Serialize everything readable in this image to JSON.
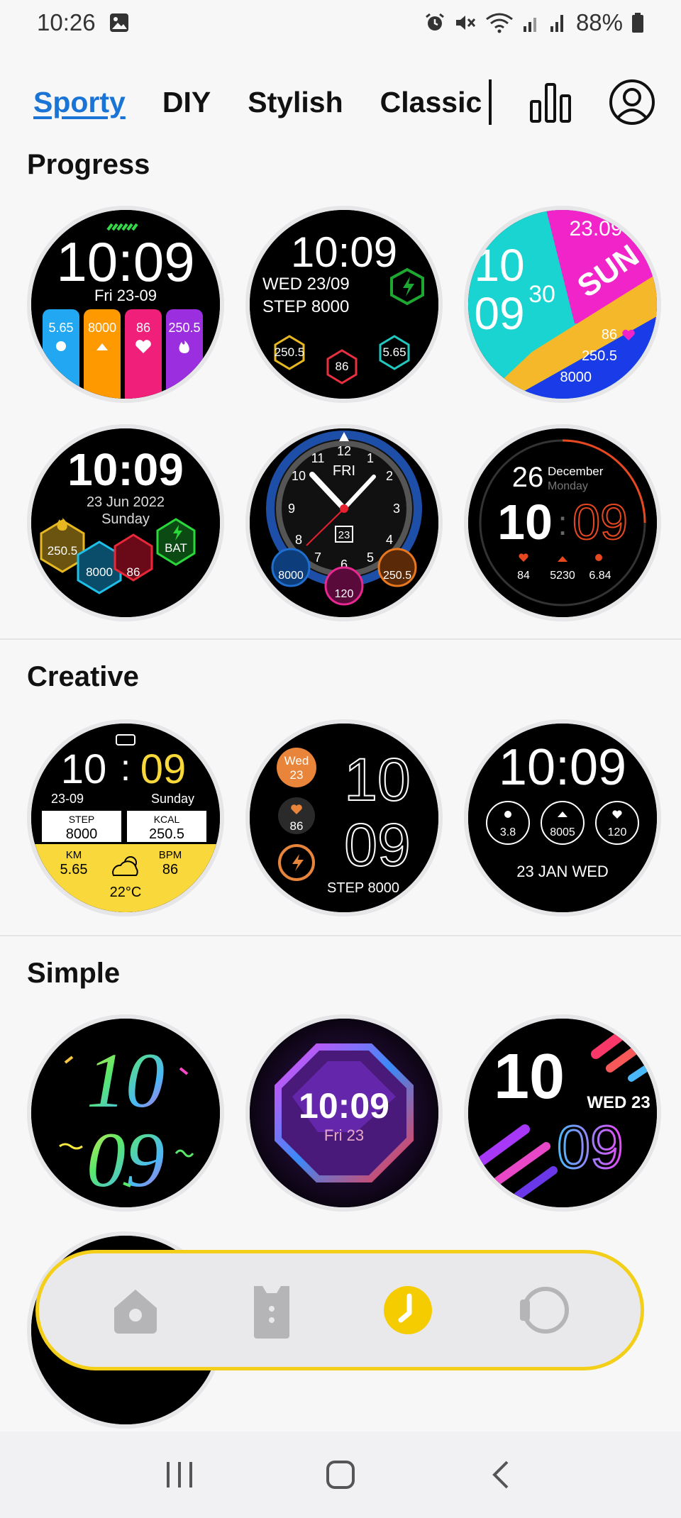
{
  "status_bar": {
    "time": "10:26",
    "battery": "88%",
    "icons": [
      "image-icon",
      "alarm-icon",
      "mute-icon",
      "wifi-icon",
      "signal-icon",
      "signal-2-icon",
      "battery-icon"
    ]
  },
  "tabs": [
    {
      "label": "Sporty",
      "active": true
    },
    {
      "label": "DIY",
      "active": false
    },
    {
      "label": "Stylish",
      "active": false
    },
    {
      "label": "Classic",
      "active": false
    }
  ],
  "header_icons": [
    "stats-icon",
    "profile-icon"
  ],
  "sections": {
    "progress": {
      "title": "Progress"
    },
    "creative": {
      "title": "Creative"
    },
    "simple": {
      "title": "Simple"
    }
  },
  "faces": {
    "p1": {
      "time": "10:09",
      "date": "Fri 23-09",
      "values": [
        "5.65",
        "8000",
        "86",
        "250.5"
      ]
    },
    "p2": {
      "time": "10:09",
      "date": "WED 23/09",
      "step": "STEP 8000",
      "values": [
        "250.5",
        "86",
        "5.65"
      ]
    },
    "p3": {
      "date": "23.09",
      "hour": "10",
      "minute": "09",
      "sec": "30",
      "day": "SUN",
      "values": [
        "86",
        "250.5",
        "8000"
      ]
    },
    "p4": {
      "time": "10:09",
      "date": "23 Jun 2022",
      "day": "Sunday",
      "values": [
        "250.5",
        "8000",
        "86",
        "BAT"
      ]
    },
    "p5": {
      "day": "FRI",
      "date": "23",
      "numbers": [
        "12",
        "1",
        "2",
        "3",
        "4",
        "5",
        "6",
        "7",
        "8",
        "9",
        "10",
        "11"
      ],
      "values": [
        "8000",
        "120",
        "250.5"
      ]
    },
    "p6": {
      "date": "26",
      "month": "December",
      "weekday": "Monday",
      "hour": "10",
      "minute": "09",
      "values": [
        "84",
        "5230",
        "6.84"
      ]
    },
    "c1": {
      "hour": "10",
      "minute": "09",
      "date": "23-09",
      "day": "Sunday",
      "step_label": "STEP",
      "step": "8000",
      "kcal_label": "KCAL",
      "kcal": "250.5",
      "km_label": "KM",
      "km": "5.65",
      "bpm_label": "BPM",
      "bpm": "86",
      "temp": "22°C"
    },
    "c2": {
      "day": "Wed",
      "date": "23",
      "heart": "86",
      "hour": "10",
      "minute": "09",
      "step": "STEP  8000"
    },
    "c3": {
      "time": "10:09",
      "values": [
        "3.8",
        "8005",
        "120"
      ],
      "date": "23 JAN WED"
    },
    "s1": {
      "hour": "10",
      "minute": "09"
    },
    "s2": {
      "time": "10:09",
      "date": "Fri 23"
    },
    "s3": {
      "hour": "10",
      "minute": "09",
      "date": "WED 23"
    }
  },
  "colors": {
    "accent": "#1a74d6",
    "nav_border": "#f3cf1a",
    "active_nav": "#f5cc00",
    "inactive_nav": "#b5b5b7"
  },
  "bottom_nav": [
    "home-icon",
    "vest-icon",
    "watch-face-icon",
    "device-icon"
  ],
  "system_nav": [
    "recent-apps-icon",
    "home-button-icon",
    "back-icon"
  ]
}
